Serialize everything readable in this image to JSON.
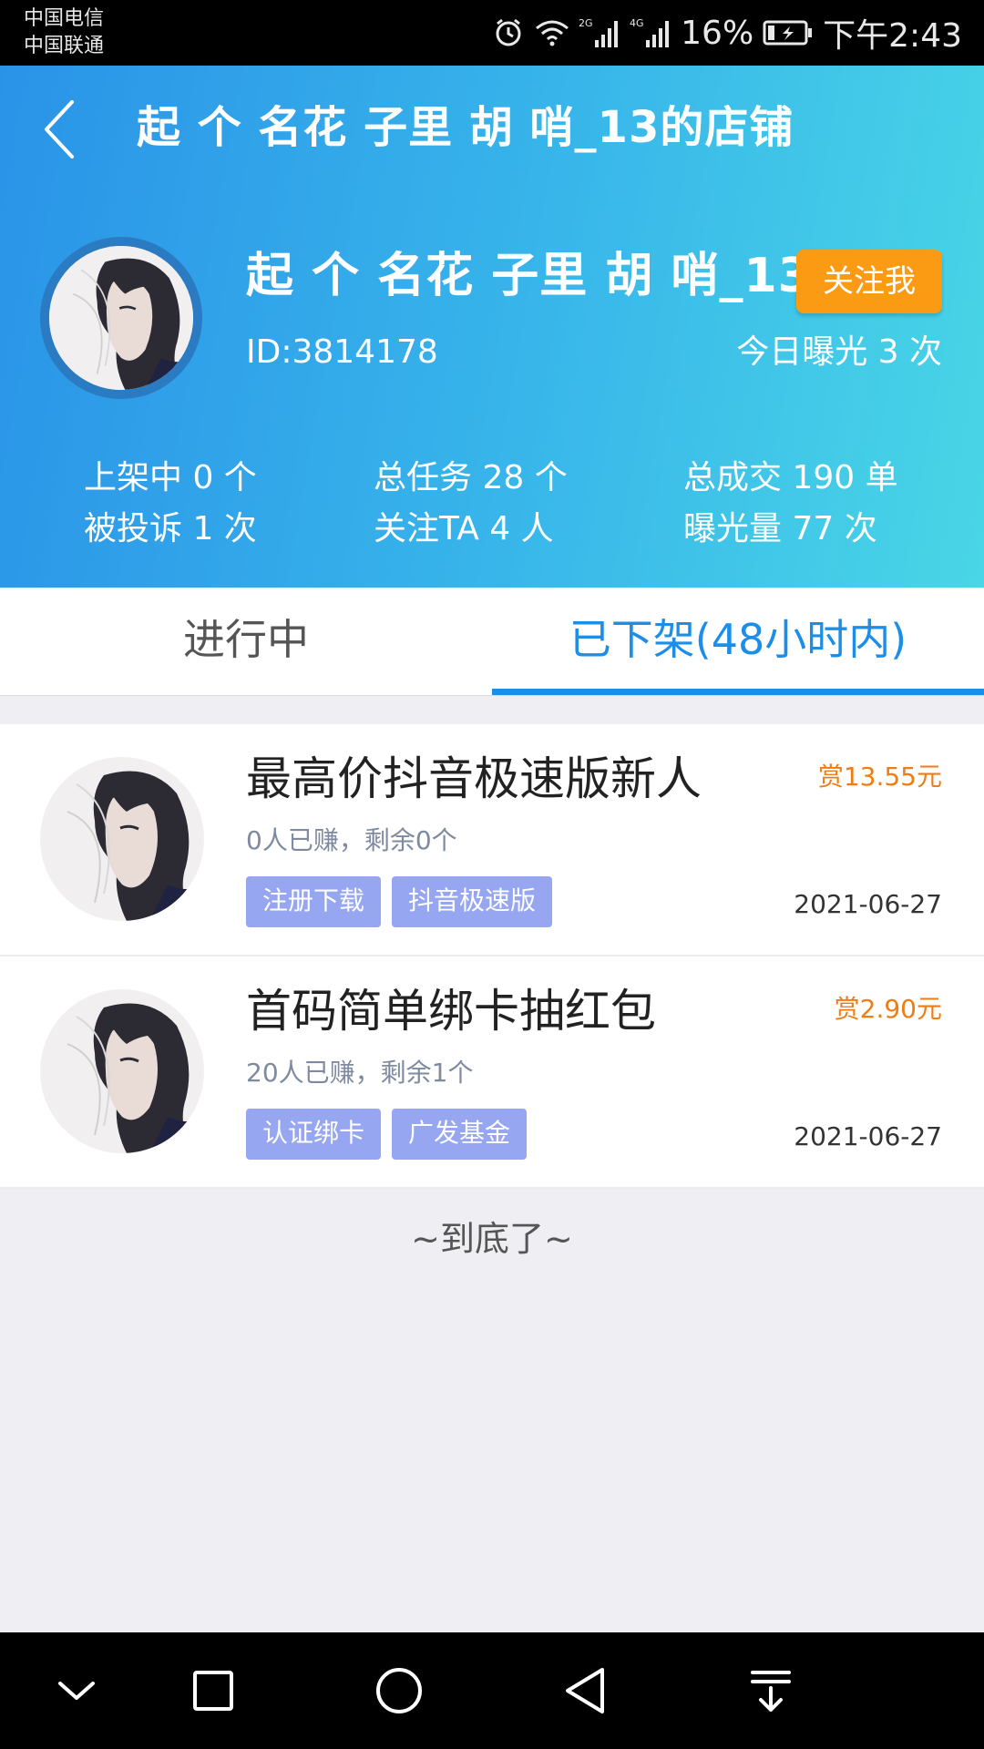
{
  "status_bar": {
    "carrier1": "中国电信",
    "carrier2": "中国联通",
    "network1": "2G",
    "network2": "4G",
    "battery": "16%",
    "time": "下午2:43"
  },
  "header": {
    "title": "起 个 名花 子里 胡 哨_13的店铺",
    "shop_name": "起 个 名花 子里 胡 哨_13",
    "follow_label": "关注我",
    "shop_id": "ID:3814178",
    "exposure_today": "今日曝光 3 次"
  },
  "stats": {
    "col1": [
      "上架中 0 个",
      "被投诉 1 次"
    ],
    "col2": [
      "总任务 28 个",
      "关注TA 4 人"
    ],
    "col3": [
      "总成交 190 单",
      "曝光量 77 次"
    ]
  },
  "tabs": [
    {
      "label": "进行中",
      "active": false
    },
    {
      "label": "已下架(48小时内)",
      "active": true
    }
  ],
  "tasks": [
    {
      "title": "最高价抖音极速版新人",
      "reward": "赏13.55元",
      "progress": "0人已赚，剩余0个",
      "tags": [
        "注册下载",
        "抖音极速版"
      ],
      "date": "2021-06-27"
    },
    {
      "title": "首码简单绑卡抽红包",
      "reward": "赏2.90元",
      "progress": "20人已赚，剩余1个",
      "tags": [
        "认证绑卡",
        "广发基金"
      ],
      "date": "2021-06-27"
    }
  ],
  "end_note": "~到底了~",
  "colors": {
    "accent": "#1c8ee8",
    "follow_button": "#fb9b14",
    "reward": "#f07c14",
    "tag": "#97a6f0"
  },
  "icons": {
    "back": "chevron-left-icon",
    "nav": [
      "chevron-down-icon",
      "square-icon",
      "circle-icon",
      "triangle-back-icon",
      "download-icon"
    ]
  }
}
